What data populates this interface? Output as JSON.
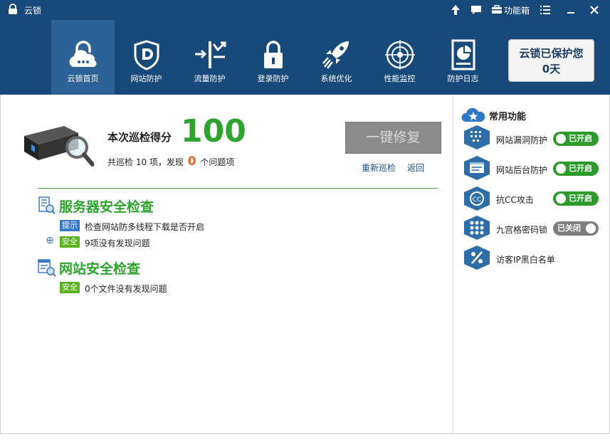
{
  "app": {
    "title": "云锁"
  },
  "titlebar": {
    "toolbox_label": "功能箱"
  },
  "nav": {
    "items": [
      {
        "label": "云锁首页",
        "icon": "cloud-lock-icon",
        "active": true
      },
      {
        "label": "网站防护",
        "icon": "shield-d-icon"
      },
      {
        "label": "流量防护",
        "icon": "traffic-icon"
      },
      {
        "label": "登录防护",
        "icon": "padlock-icon"
      },
      {
        "label": "系统优化",
        "icon": "rocket-icon"
      },
      {
        "label": "性能监控",
        "icon": "radar-icon"
      },
      {
        "label": "防护日志",
        "icon": "log-report-icon"
      }
    ]
  },
  "protect_status": {
    "line1": "云锁已保护您",
    "line2": "0天"
  },
  "scan": {
    "score_label": "本次巡检得分",
    "score": "100",
    "summary_prefix": "共巡检 10 项，发现",
    "issue_count": "0",
    "summary_suffix": "个问题项",
    "fix_button": "一键修复",
    "rescan_link": "重新巡检",
    "back_link": "返回"
  },
  "server_check": {
    "title": "服务器安全检查",
    "rows": [
      {
        "tag": "提示",
        "text": "检查网站防多线程下载是否开启"
      },
      {
        "tag": "安全",
        "text": "9项没有发现问题"
      }
    ]
  },
  "site_check": {
    "title": "网站安全检查",
    "rows": [
      {
        "tag": "安全",
        "text": "0个文件没有发现问题"
      }
    ]
  },
  "common_functions": {
    "title": "常用功能",
    "items": [
      {
        "label": "网站漏洞防护",
        "status": "已开启",
        "on": true
      },
      {
        "label": "网站后台防护",
        "status": "已开启",
        "on": true
      },
      {
        "label": "抗CC攻击",
        "status": "已开启",
        "on": true
      },
      {
        "label": "九宫格密码锁",
        "status": "已关闭",
        "on": false
      },
      {
        "label": "访客IP黑白名单"
      }
    ]
  },
  "colors": {
    "header": "#17497a",
    "accent_green": "#2ea32e",
    "issue_orange": "#e8601c",
    "tag_blue": "#3a78c8"
  }
}
